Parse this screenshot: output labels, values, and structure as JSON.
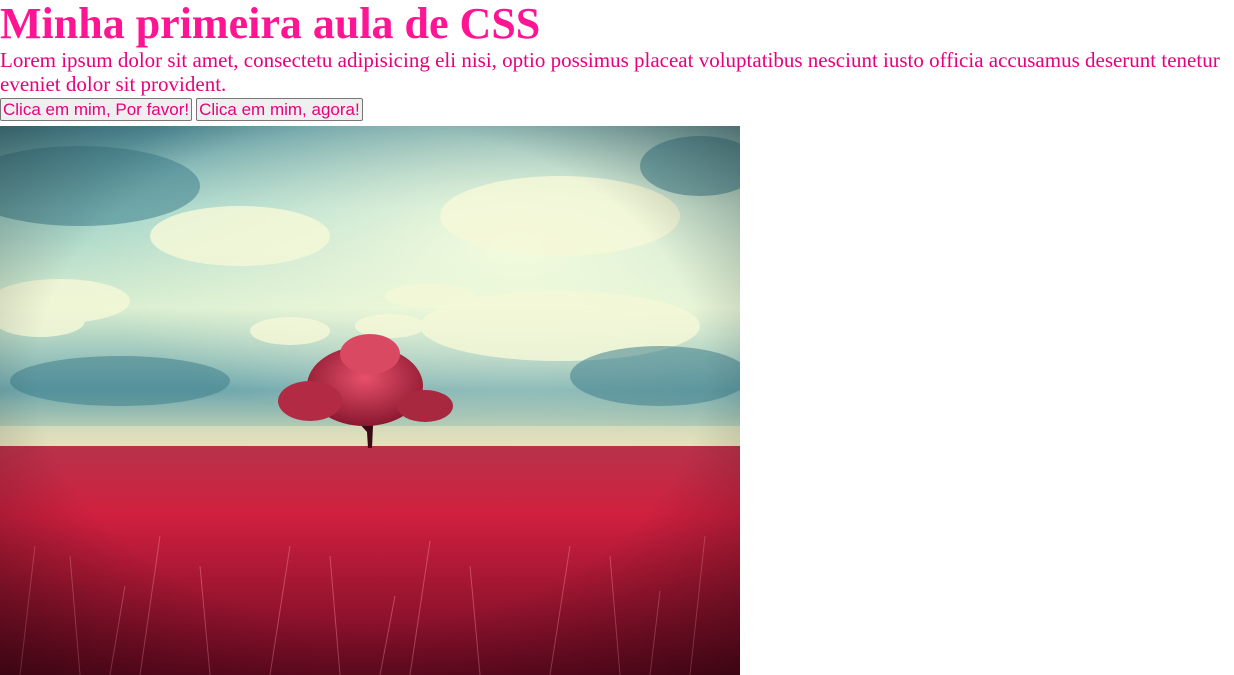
{
  "header": {
    "title": "Minha primeira aula de CSS"
  },
  "intro": {
    "text": "Lorem ipsum dolor sit amet, consectetu adipisicing eli nisi, optio possimus placeat voluptatibus nesciunt iusto officia accusamus deserunt tenetur eveniet dolor sit provident."
  },
  "buttons": [
    {
      "label": "Clica em mim, Por favor!"
    },
    {
      "label": "Clica em mim, agora!"
    }
  ],
  "colors": {
    "heading": "#ff1493",
    "text": "#e6007e",
    "sky_top": "#5aa3b0",
    "sky_light": "#eaf4c8",
    "field": "#c81e3c",
    "tree": "#c6304a"
  },
  "image": {
    "subject": "lone red tree in red grass field under cloudy teal sky"
  }
}
